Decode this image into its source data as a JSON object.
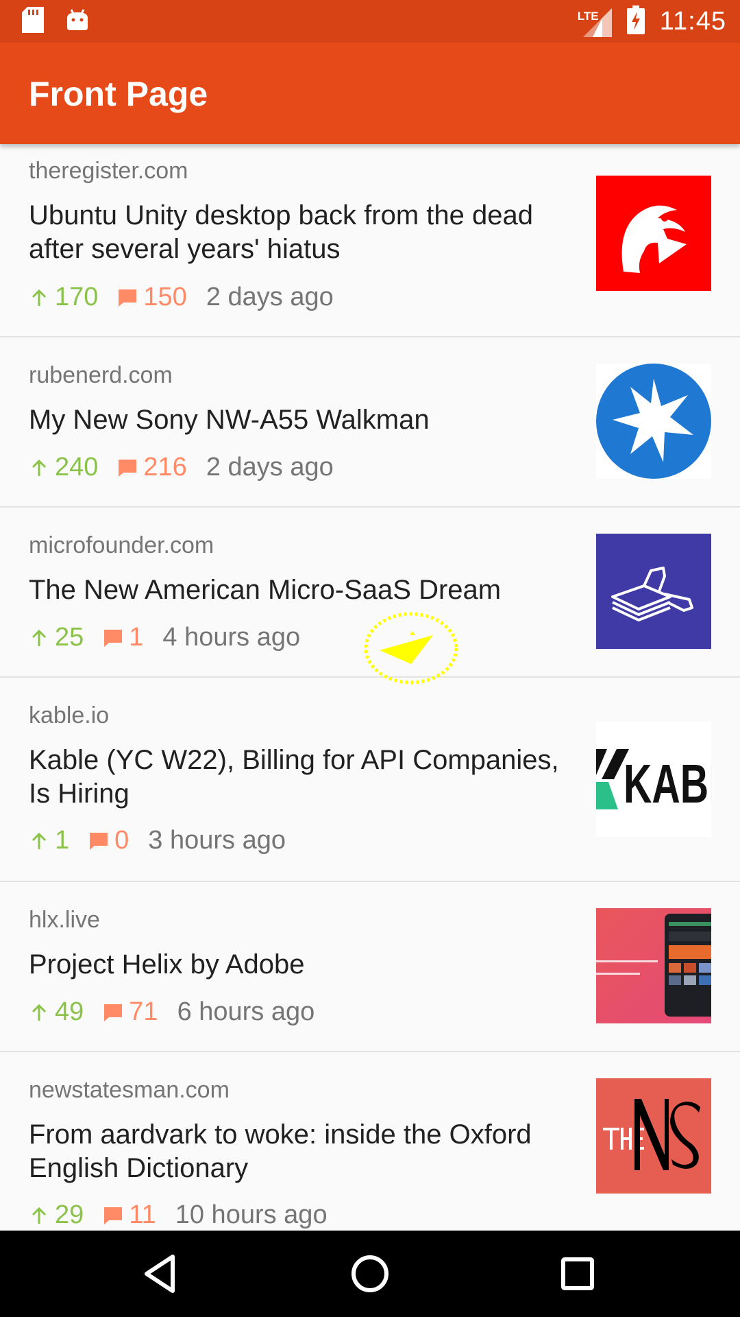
{
  "status_bar": {
    "time": "11:45",
    "network": "LTE",
    "left_icons": [
      "sd-card-icon",
      "android-icon"
    ],
    "right_icons": [
      "signal-icon",
      "battery-charging-icon"
    ]
  },
  "app_bar": {
    "title": "Front Page",
    "color": "#e64a19"
  },
  "stories": [
    {
      "domain": "theregister.com",
      "title": "Ubuntu Unity desktop back from the dead after several years' hiatus",
      "points": "170",
      "comments": "150",
      "time": "2 days ago",
      "thumbnail": "theregister-vulture-logo"
    },
    {
      "domain": "rubenerd.com",
      "title": "My New Sony NW-A55 Walkman",
      "points": "240",
      "comments": "216",
      "time": "2 days ago",
      "thumbnail": "rubenerd-star-logo"
    },
    {
      "domain": "microfounder.com",
      "title": "The New American Micro-SaaS Dream",
      "points": "25",
      "comments": "1",
      "time": "4 hours ago",
      "thumbnail": "microfounder-logo"
    },
    {
      "domain": "kable.io",
      "title": "Kable (YC W22), Billing for API Companies, Is Hiring",
      "points": "1",
      "comments": "0",
      "time": "3 hours ago",
      "thumbnail": "kable-logo",
      "thumb_text": "KABI"
    },
    {
      "domain": "hlx.live",
      "title": "Project Helix by Adobe",
      "points": "49",
      "comments": "71",
      "time": "6 hours ago",
      "thumbnail": "helix-screenshot"
    },
    {
      "domain": "newstatesman.com",
      "title": "From aardvark to woke: inside the Oxford English Dictionary",
      "points": "29",
      "comments": "11",
      "time": "10 hours ago",
      "thumbnail": "newstatesman-logo"
    }
  ],
  "colors": {
    "points": "#8bc34a",
    "comments": "#ff8a65",
    "status_bar": "#d84315"
  },
  "nav_bar": {
    "buttons": [
      "back-icon",
      "home-icon",
      "recents-icon"
    ]
  }
}
